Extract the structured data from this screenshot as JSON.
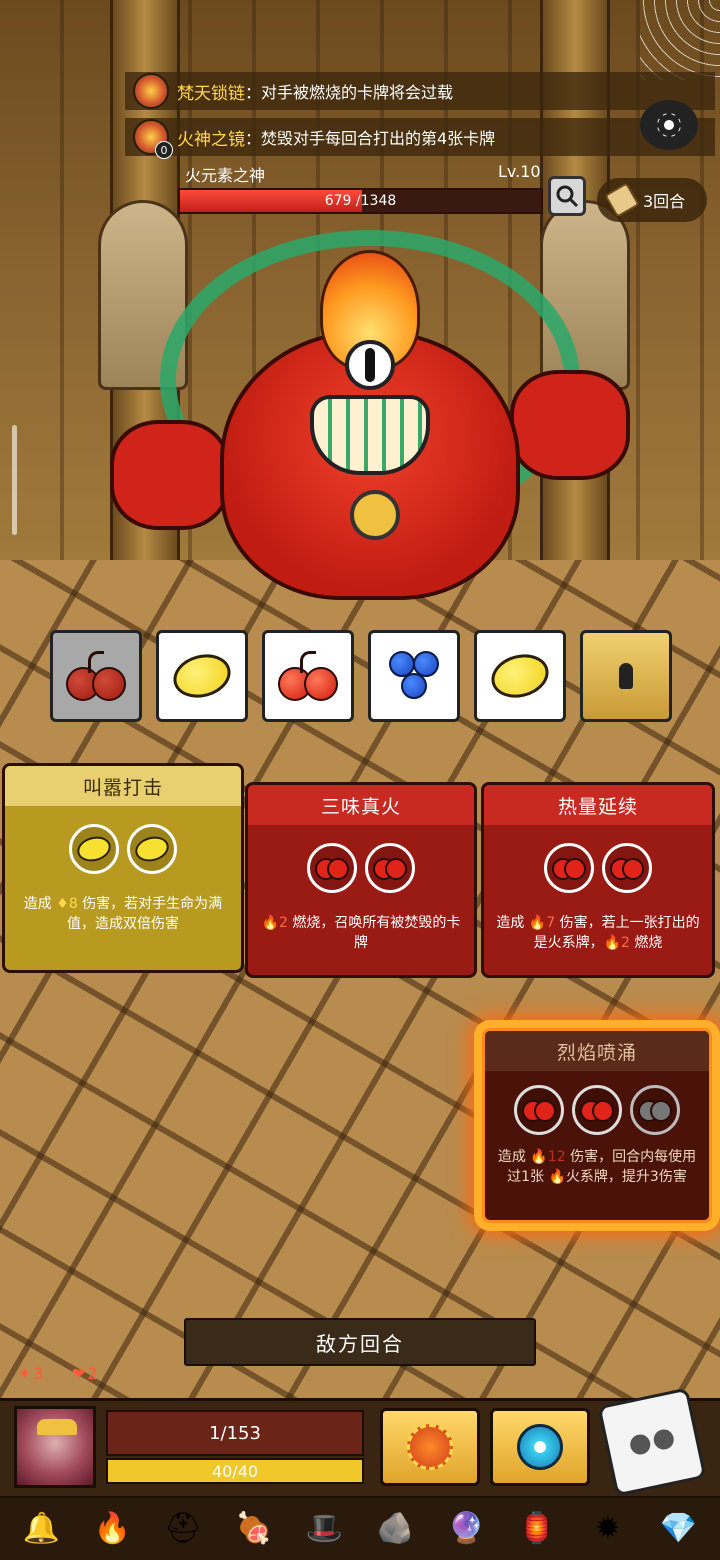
{
  "buffs": [
    {
      "name": "梵天锁链",
      "desc": "：对手被燃烧的卡牌将会过载",
      "icon": "chain-relic-icon"
    },
    {
      "name": "火神之镜",
      "desc": "：焚毁对手每回合打出的第4张卡牌",
      "icon": "fire-mirror-icon",
      "counter": "0"
    }
  ],
  "boss": {
    "name": "火元素之神",
    "level": "Lv.10",
    "hp_text": "679 /1348",
    "hp_fraction": 0.504
  },
  "rounds": {
    "label": "3回合"
  },
  "slots": [
    {
      "fruit": "cherry",
      "used": true
    },
    {
      "fruit": "lemon",
      "used": false
    },
    {
      "fruit": "cherry",
      "used": false
    },
    {
      "fruit": "blueberry",
      "used": false
    },
    {
      "fruit": "lemon",
      "used": false
    },
    {
      "fruit": "locked",
      "used": false
    }
  ],
  "cards": [
    {
      "title": "叫嚣打击",
      "dice": [
        "lemon",
        "lemon"
      ],
      "desc_pre": "造成 ",
      "num": "8",
      "desc_post": " 伤害，若对手生命为满值，造成双倍伤害",
      "color": "#b89a20"
    },
    {
      "title": "三味真火",
      "dice": [
        "cherry",
        "cherry"
      ],
      "desc_pre": "",
      "num": "2",
      "desc_post": " 燃烧，召唤所有被焚毁的卡牌",
      "color": "#9a1a14"
    },
    {
      "title": "热量延续",
      "dice": [
        "cherry",
        "cherry"
      ],
      "desc_pre": "造成 ",
      "num": "7",
      "desc_post": " 伤害，若上一张打出的是火系牌，",
      "num2": "2",
      "desc_tail": " 燃烧",
      "color": "#9a1a14"
    },
    {
      "title": "烈焰喷涌",
      "dice": [
        "cherry",
        "cherry",
        "empty"
      ],
      "desc_pre": "造成 ",
      "num": "12",
      "desc_post": " 伤害，回合内每使用过1张 ",
      "desc_tail": "火系牌，提升3伤害",
      "color": "#6a1a10"
    }
  ],
  "enemy_turn_label": "敌方回合",
  "player": {
    "burn_stat": "3",
    "heart_stat": "2",
    "shield_text": "1/153",
    "hp_text": "40/40",
    "hp_fraction": 1.0
  },
  "relics": [
    "bell-icon",
    "fire-skull-icon",
    "helmet-icon",
    "meat-icon",
    "hood-icon",
    "stone-icon",
    "orb-icon",
    "lantern-icon",
    "spiky-ball-icon",
    "crystal-icon"
  ]
}
